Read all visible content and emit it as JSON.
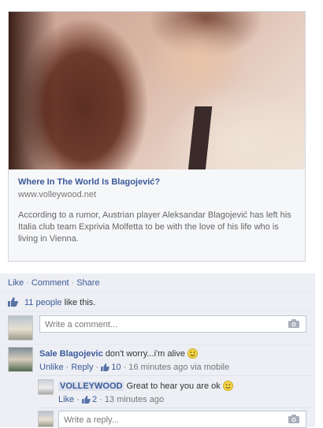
{
  "card": {
    "title": "Where In The World Is Blagojević?",
    "domain": "www.volleywood.net",
    "description": "According to a rumor, Austrian player Aleksandar Blagojević has left his Italia club team Exprivia Molfetta to be with the love of his life who is living in Vienna."
  },
  "actions": {
    "like": "Like",
    "comment": "Comment",
    "share": "Share"
  },
  "likes": {
    "count_link": "11 people",
    "suffix": "like this."
  },
  "comment_box": {
    "placeholder": "Write a comment..."
  },
  "comments": [
    {
      "author": "Sale Blagojevic",
      "text": "don't worry...i'm alive",
      "unlike": "Unlike",
      "reply": "Reply",
      "like_count": "10",
      "time": "16 minutes ago via mobile"
    }
  ],
  "reply": {
    "author": "VOLLEYWOOD",
    "text": "Great to hear you are ok",
    "like": "Like",
    "like_count": "2",
    "time": "13 minutes ago"
  },
  "reply_box": {
    "placeholder": "Write a reply..."
  },
  "colors": {
    "link": "#3b5998",
    "ufi_bg": "#edeff4",
    "border": "#bdc7d8"
  },
  "icons": {
    "like": "thumbs-up-icon",
    "camera": "camera-icon",
    "emoji": "smile-icon"
  }
}
